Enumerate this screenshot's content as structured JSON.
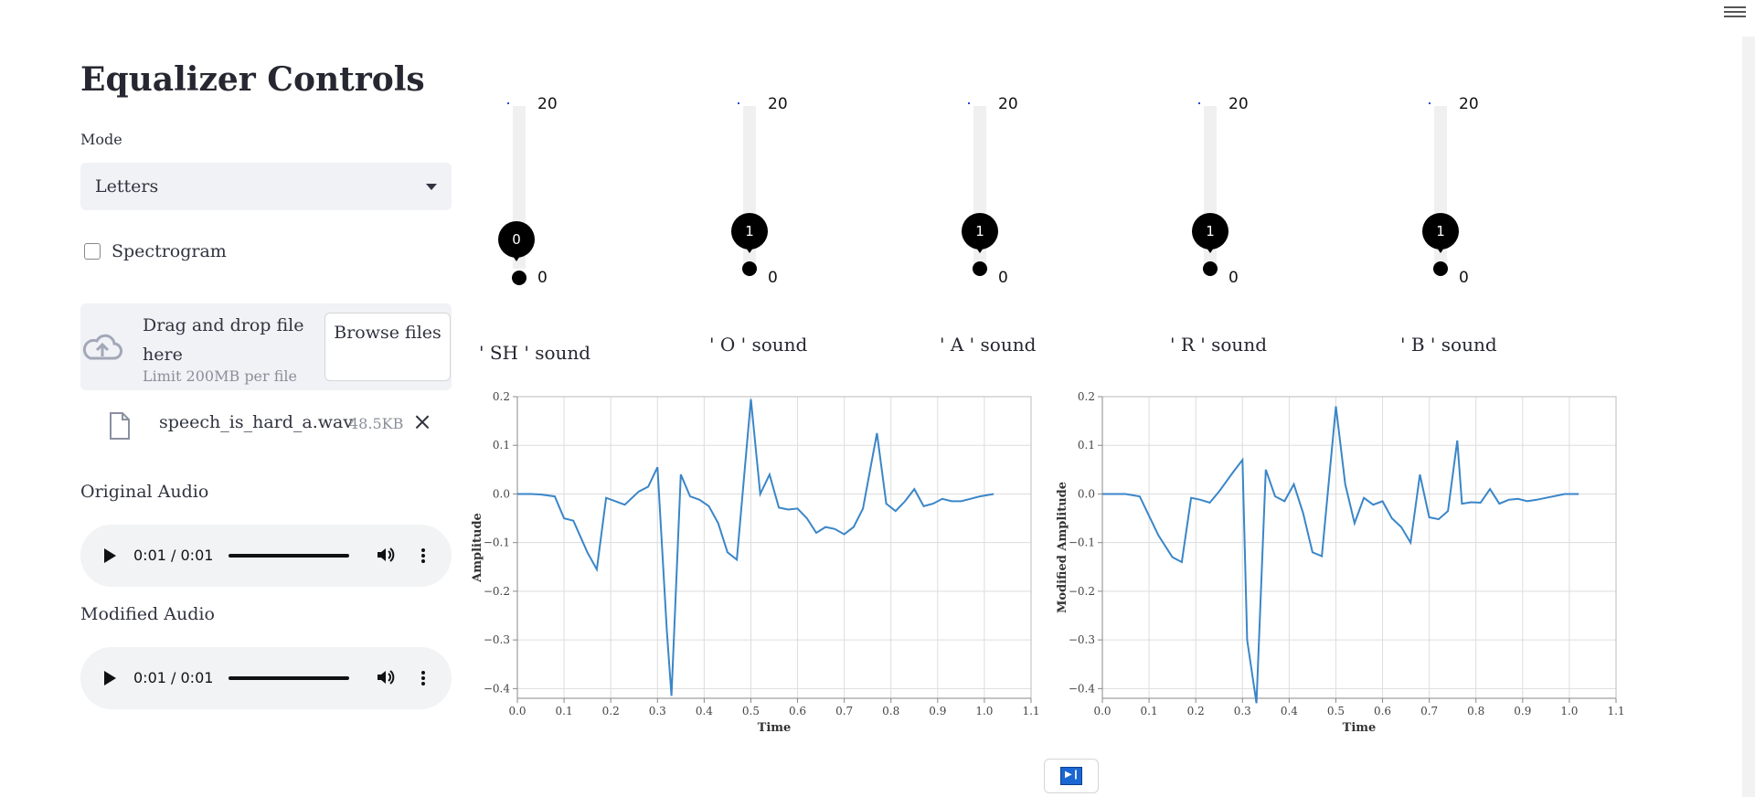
{
  "sidebar": {
    "title": "Equalizer Controls",
    "mode_label": "Mode",
    "mode_value": "Letters",
    "spectrogram_label": "Spectrogram",
    "spectrogram_checked": false,
    "uploader": {
      "drop_text": "Drag and drop file here",
      "limit_text": "Limit 200MB per file",
      "browse_label": "Browse files"
    },
    "file": {
      "name": "speech_is_hard_a.wav",
      "size": "48.5KB"
    },
    "original_audio": {
      "label": "Original Audio",
      "time": "0:01 / 0:01"
    },
    "modified_audio": {
      "label": "Modified Audio",
      "time": "0:01 / 0:01"
    }
  },
  "sliders": [
    {
      "label": "' SH ' sound",
      "value": "0",
      "max": "20",
      "min": "0"
    },
    {
      "label": "' O ' sound",
      "value": "1",
      "max": "20",
      "min": "0"
    },
    {
      "label": "' A ' sound",
      "value": "1",
      "max": "20",
      "min": "0"
    },
    {
      "label": "' R ' sound",
      "value": "1",
      "max": "20",
      "min": "0"
    },
    {
      "label": "' B ' sound",
      "value": "1",
      "max": "20",
      "min": "0"
    }
  ],
  "colors": {
    "line": "#3a86c8",
    "grid": "#dddddd",
    "accent": "#000000"
  },
  "chart_data": [
    {
      "type": "line",
      "xlabel": "Time",
      "ylabel": "Amplitude",
      "xlim": [
        0.0,
        1.1
      ],
      "ylim": [
        -0.42,
        0.2
      ],
      "xticks": [
        "0.0",
        "0.1",
        "0.2",
        "0.3",
        "0.4",
        "0.5",
        "0.6",
        "0.7",
        "0.8",
        "0.9",
        "1.0",
        "1.1"
      ],
      "yticks": [
        "0.2",
        "0.1",
        "0.0",
        "−0.1",
        "−0.2",
        "−0.3",
        "−0.4"
      ],
      "grid": true,
      "x": [
        0.0,
        0.03,
        0.05,
        0.08,
        0.1,
        0.12,
        0.15,
        0.17,
        0.19,
        0.21,
        0.23,
        0.26,
        0.28,
        0.3,
        0.32,
        0.33,
        0.35,
        0.37,
        0.39,
        0.41,
        0.43,
        0.45,
        0.47,
        0.5,
        0.52,
        0.54,
        0.56,
        0.58,
        0.6,
        0.62,
        0.64,
        0.66,
        0.68,
        0.7,
        0.72,
        0.74,
        0.77,
        0.79,
        0.81,
        0.83,
        0.85,
        0.87,
        0.89,
        0.91,
        0.93,
        0.95,
        0.97,
        0.99,
        1.02
      ],
      "y": [
        0.0,
        0.0,
        -0.001,
        -0.005,
        -0.05,
        -0.055,
        -0.12,
        -0.155,
        -0.008,
        -0.015,
        -0.022,
        0.005,
        0.015,
        0.055,
        -0.28,
        -0.415,
        0.04,
        -0.005,
        -0.012,
        -0.025,
        -0.06,
        -0.12,
        -0.135,
        0.195,
        0.0,
        0.04,
        -0.028,
        -0.032,
        -0.03,
        -0.05,
        -0.08,
        -0.068,
        -0.072,
        -0.083,
        -0.068,
        -0.03,
        0.125,
        -0.02,
        -0.035,
        -0.015,
        0.01,
        -0.025,
        -0.02,
        -0.01,
        -0.015,
        -0.015,
        -0.01,
        -0.005,
        0.0
      ]
    },
    {
      "type": "line",
      "xlabel": "Time",
      "ylabel": "Modified Amplitude",
      "xlim": [
        0.0,
        1.1
      ],
      "ylim": [
        -0.42,
        0.2
      ],
      "xticks": [
        "0.0",
        "0.1",
        "0.2",
        "0.3",
        "0.4",
        "0.5",
        "0.6",
        "0.7",
        "0.8",
        "0.9",
        "1.0",
        "1.1"
      ],
      "yticks": [
        "0.2",
        "0.1",
        "0.0",
        "−0.1",
        "−0.2",
        "−0.3",
        "−0.4"
      ],
      "grid": true,
      "x": [
        0.0,
        0.03,
        0.05,
        0.08,
        0.1,
        0.12,
        0.15,
        0.17,
        0.19,
        0.21,
        0.23,
        0.25,
        0.28,
        0.3,
        0.31,
        0.33,
        0.35,
        0.37,
        0.39,
        0.41,
        0.43,
        0.45,
        0.47,
        0.5,
        0.52,
        0.54,
        0.56,
        0.58,
        0.6,
        0.62,
        0.64,
        0.66,
        0.68,
        0.7,
        0.72,
        0.74,
        0.76,
        0.77,
        0.79,
        0.81,
        0.83,
        0.85,
        0.87,
        0.89,
        0.91,
        0.93,
        0.95,
        0.97,
        0.99,
        1.02
      ],
      "y": [
        0.0,
        0.0,
        0.0,
        -0.005,
        -0.045,
        -0.085,
        -0.13,
        -0.14,
        -0.008,
        -0.012,
        -0.018,
        0.005,
        0.045,
        0.07,
        -0.3,
        -0.43,
        0.05,
        -0.005,
        -0.015,
        0.02,
        -0.04,
        -0.12,
        -0.128,
        0.18,
        0.02,
        -0.06,
        -0.008,
        -0.022,
        -0.015,
        -0.05,
        -0.068,
        -0.1,
        0.04,
        -0.048,
        -0.052,
        -0.035,
        0.11,
        -0.02,
        -0.017,
        -0.018,
        0.01,
        -0.02,
        -0.012,
        -0.01,
        -0.015,
        -0.012,
        -0.008,
        -0.004,
        0.0,
        0.0
      ]
    }
  ]
}
